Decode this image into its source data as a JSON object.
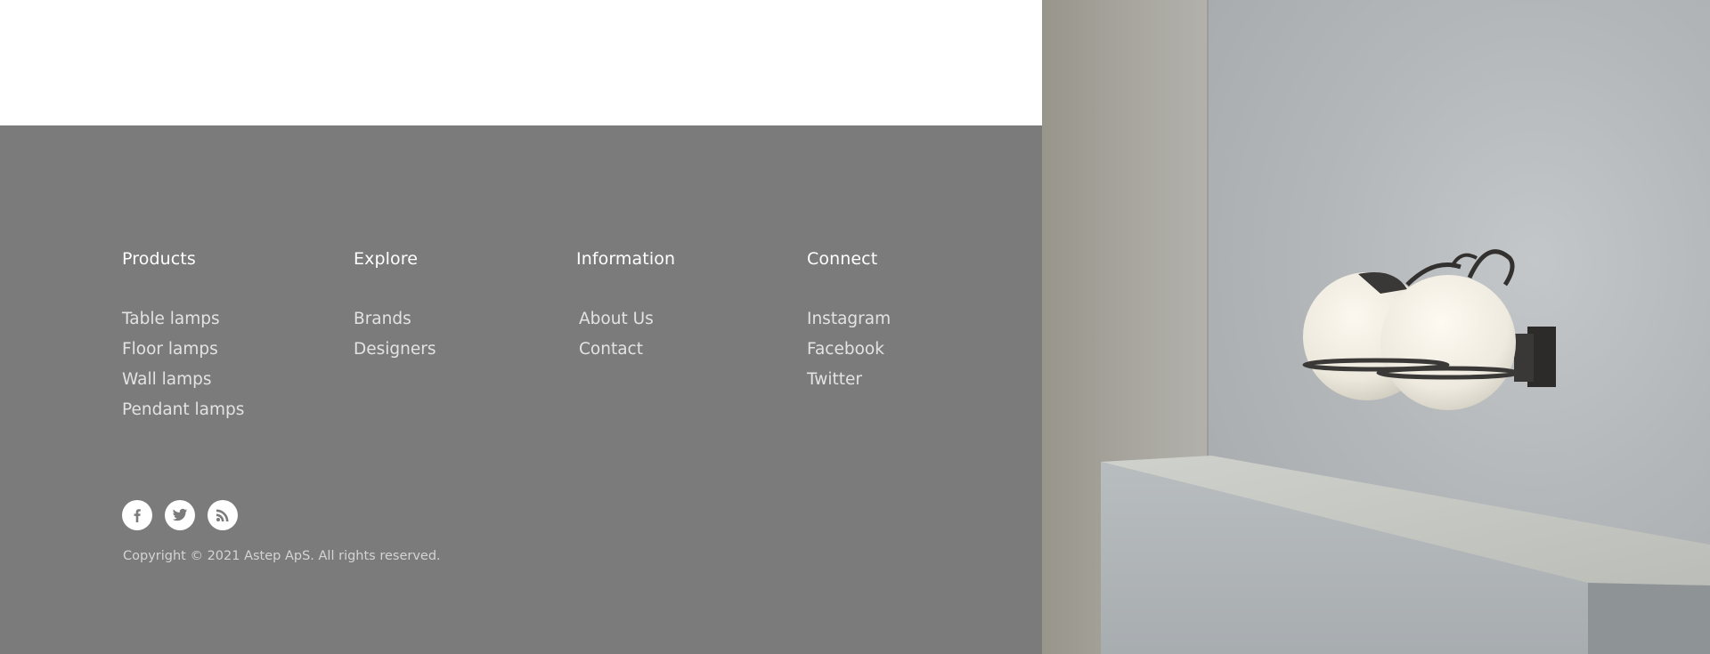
{
  "footer": {
    "columns": [
      {
        "heading": "Products",
        "links": [
          "Table lamps",
          "Floor lamps",
          "Wall lamps",
          "Pendant lamps"
        ]
      },
      {
        "heading": "Explore",
        "links": [
          "Brands",
          "Designers"
        ]
      },
      {
        "heading": "Information",
        "links": [
          "About Us",
          "Contact"
        ]
      },
      {
        "heading": "Connect",
        "links": [
          "Instagram",
          "Facebook",
          "Twitter"
        ]
      }
    ],
    "social_icons": [
      "facebook-icon",
      "twitter-icon",
      "rss-icon"
    ],
    "copyright": "Copyright © 2021 Astep ApS. All rights reserved."
  },
  "colors": {
    "footer_background": "#7b7b7b",
    "heading_text": "#ffffff",
    "link_text": "#e3e3e3",
    "page_background": "#ffffff"
  }
}
